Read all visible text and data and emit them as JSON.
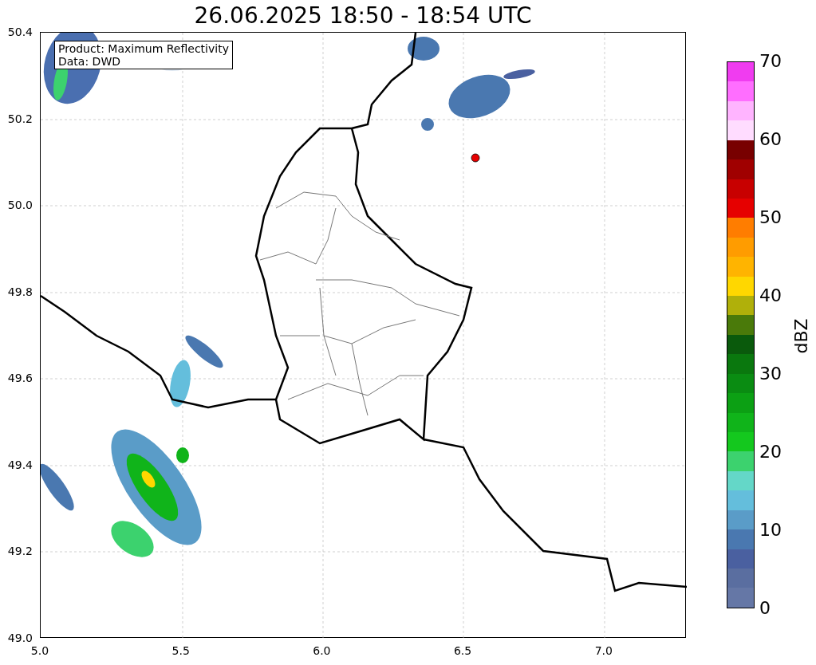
{
  "title": "26.06.2025 18:50 - 18:54 UTC",
  "legend": [
    "Product: Maximum Reflectivity",
    "Data: DWD"
  ],
  "x_ticks": [
    "5.0",
    "5.5",
    "6.0",
    "6.5",
    "7.0"
  ],
  "y_ticks": [
    "50.4",
    "50.2",
    "50.0",
    "49.8",
    "49.6",
    "49.4",
    "49.2",
    "49.0"
  ],
  "colorbar": {
    "label": "dBZ",
    "ticks": [
      "70",
      "60",
      "50",
      "40",
      "30",
      "20",
      "10",
      "0"
    ],
    "bands": [
      {
        "color": "#f03cf0"
      },
      {
        "color": "#ff6eff"
      },
      {
        "color": "#ffb4ff"
      },
      {
        "color": "#ffdcff"
      },
      {
        "color": "#780000"
      },
      {
        "color": "#a00000"
      },
      {
        "color": "#c80000"
      },
      {
        "color": "#e60000"
      },
      {
        "color": "#ff7d00"
      },
      {
        "color": "#ff9c00"
      },
      {
        "color": "#ffb400"
      },
      {
        "color": "#ffd700"
      },
      {
        "color": "#b0b00a"
      },
      {
        "color": "#4a7a0a"
      },
      {
        "color": "#0a5a0c"
      },
      {
        "color": "#0a780e"
      },
      {
        "color": "#0a8c12"
      },
      {
        "color": "#0ca014"
      },
      {
        "color": "#10b41a"
      },
      {
        "color": "#14c81e"
      },
      {
        "color": "#3cd26e"
      },
      {
        "color": "#64d7c8"
      },
      {
        "color": "#64bedc"
      },
      {
        "color": "#5a9cc8"
      },
      {
        "color": "#4a78b0"
      },
      {
        "color": "#4a60a0"
      },
      {
        "color": "#5a6ea0"
      },
      {
        "color": "#6577a6"
      }
    ]
  }
}
